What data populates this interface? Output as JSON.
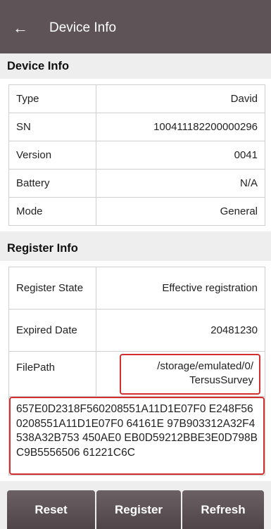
{
  "appbar": {
    "title": "Device Info",
    "back_icon": "arrow-left-icon"
  },
  "device_info": {
    "header": "Device Info",
    "rows": [
      {
        "label": "Type",
        "value": "David"
      },
      {
        "label": "SN",
        "value": "100411182200000296"
      },
      {
        "label": "Version",
        "value": "0041"
      },
      {
        "label": "Battery",
        "value": "N/A"
      },
      {
        "label": "Mode",
        "value": "General"
      }
    ]
  },
  "register_info": {
    "header": "Register Info",
    "state_label": "Register State",
    "state_value": "Effective registration",
    "expired_label": "Expired Date",
    "expired_value": "20481230",
    "filepath_label": "FilePath",
    "filepath_value": "/storage/emulated/0/ TersusSurvey",
    "key": "657E0D2318F560208551A11D1E07F0 E248F560208551A11D1E07F0 64161E 97B903312A32F4538A32B753 450AE0 EB0D59212BBE3E0D798BC9B5556506 61221C6C"
  },
  "buttons": {
    "reset": "Reset",
    "register": "Register",
    "refresh": "Refresh"
  },
  "colors": {
    "appbar": "#5e5356",
    "highlight": "#d32f2f",
    "button": "#5a4f52"
  }
}
